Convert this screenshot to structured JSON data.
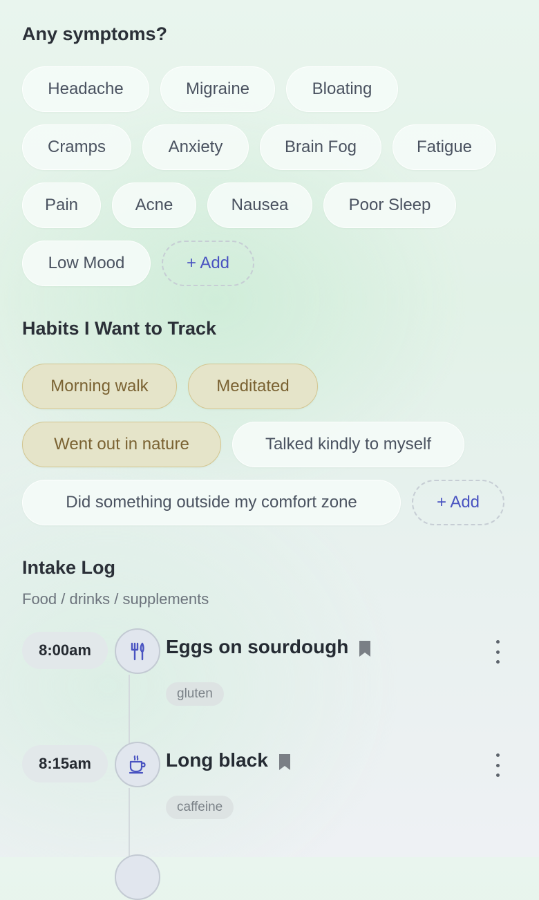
{
  "symptoms": {
    "title": "Any symptoms?",
    "chips": [
      "Headache",
      "Migraine",
      "Bloating",
      "Cramps",
      "Anxiety",
      "Brain Fog",
      "Fatigue",
      "Pain",
      "Acne",
      "Nausea",
      "Poor Sleep",
      "Low Mood"
    ],
    "add_label": "+ Add"
  },
  "habits": {
    "title": "Habits I Want to Track",
    "chips": [
      {
        "label": "Morning walk",
        "selected": true
      },
      {
        "label": "Meditated",
        "selected": true
      },
      {
        "label": "Went out in nature",
        "selected": true
      },
      {
        "label": "Talked kindly to myself",
        "selected": false
      },
      {
        "label": "Did something outside my comfort zone",
        "selected": false
      }
    ],
    "add_label": "+ Add"
  },
  "intake": {
    "title": "Intake Log",
    "subtitle": "Food / drinks / supplements",
    "entries": [
      {
        "time": "8:00am",
        "icon": "fork-knife-icon",
        "title": "Eggs on sourdough",
        "tag": "gluten"
      },
      {
        "time": "8:15am",
        "icon": "coffee-cup-icon",
        "title": "Long black",
        "tag": "caffeine"
      }
    ]
  },
  "colors": {
    "accent": "#4953c1",
    "selected_chip_bg": "#e5e4c9",
    "selected_chip_text": "#7a6232"
  }
}
